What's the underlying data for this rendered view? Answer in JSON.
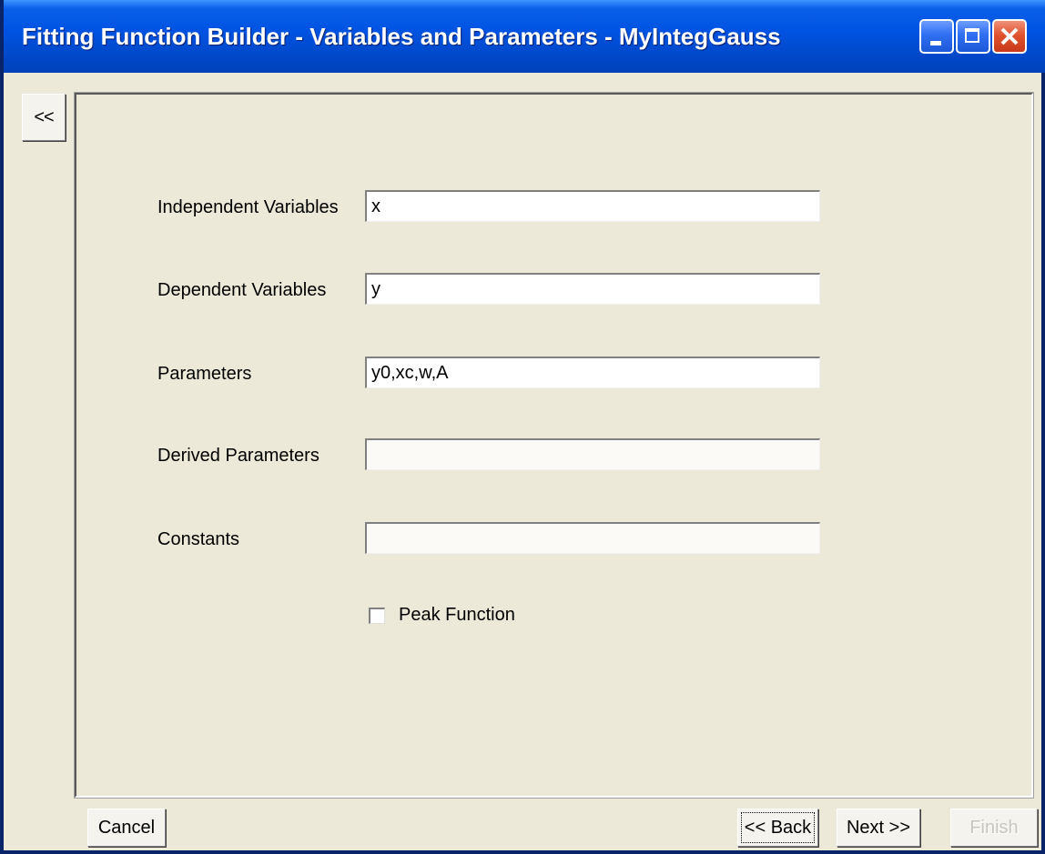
{
  "window": {
    "title": "Fitting Function Builder - Variables and Parameters - MyIntegGauss"
  },
  "sidebar": {
    "collapse_label": "<<"
  },
  "form": {
    "independent_variables": {
      "label": "Independent Variables",
      "value": "x"
    },
    "dependent_variables": {
      "label": "Dependent Variables",
      "value": "y"
    },
    "parameters": {
      "label": "Parameters",
      "value": "y0,xc,w,A"
    },
    "derived_parameters": {
      "label": "Derived Parameters",
      "value": ""
    },
    "constants": {
      "label": "Constants",
      "value": ""
    },
    "peak_function": {
      "label": "Peak Function",
      "checked": false
    }
  },
  "footer": {
    "cancel_label": "Cancel",
    "back_label": "<< Back",
    "next_label": "Next >>",
    "finish_label": "Finish"
  }
}
